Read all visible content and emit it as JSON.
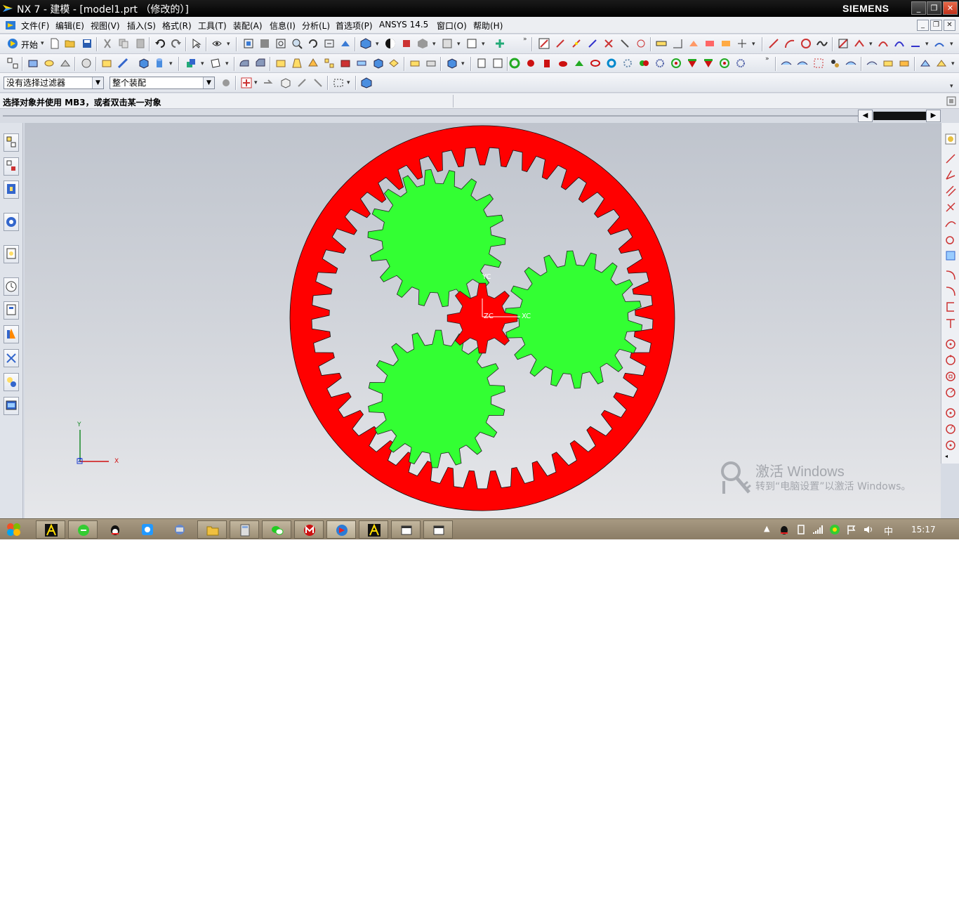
{
  "window": {
    "title": "NX 7 - 建模 - [model1.prt （修改的）]",
    "brand": "SIEMENS",
    "min": "_",
    "restore": "❐",
    "close": "✕"
  },
  "menu": {
    "items": [
      "文件(F)",
      "编辑(E)",
      "视图(V)",
      "插入(S)",
      "格式(R)",
      "工具(T)",
      "装配(A)",
      "信息(I)",
      "分析(L)",
      "首选项(P)",
      "ANSYS 14.5",
      "窗口(O)",
      "帮助(H)"
    ]
  },
  "toolbar": {
    "start_label": "开始",
    "filter_dropdown": "没有选择过滤器",
    "scope_dropdown": "整个装配"
  },
  "cue": {
    "text": "选择对象并使用 MB3，或者双击某一对象"
  },
  "viewport": {
    "triad": {
      "x": "X",
      "y": "Y",
      "z": "Z"
    },
    "csys_labels": {
      "zc": "ZC",
      "xc": "XC",
      "yc": "YC"
    },
    "ring_gear_color": "#ff0000",
    "planet_gear_color": "#33ff33",
    "sun_gear_color": "#ff0000",
    "ring_internal_teeth": 45,
    "planet_teeth": 18,
    "sun_teeth": 8
  },
  "watermark": {
    "title": "激活 Windows",
    "subtitle": "转到“电脑设置”以激活 Windows。"
  },
  "taskbar": {
    "clock": "15:17",
    "ime": "中"
  }
}
